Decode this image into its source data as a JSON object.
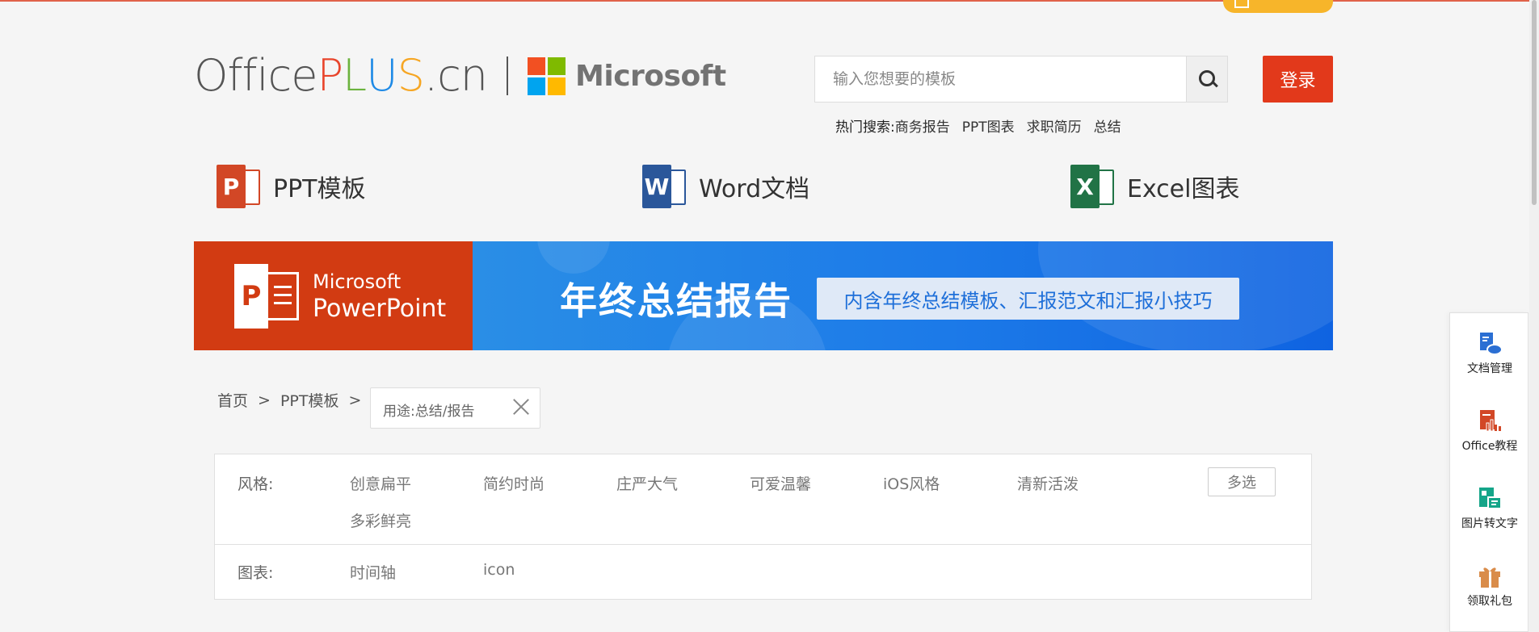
{
  "logo": {
    "office": "Office",
    "plus": [
      "P",
      "L",
      "U",
      "S"
    ],
    "domain": ".cn",
    "microsoft": "Microsoft"
  },
  "search": {
    "placeholder": "输入您想要的模板",
    "login_label": "登录",
    "hot_label": "热门搜索:",
    "hot_keywords": [
      "商务报告",
      "PPT图表",
      "求职简历",
      "总结"
    ]
  },
  "nav": {
    "ppt": {
      "label": "PPT模板",
      "letter": "P",
      "color": "#d24726"
    },
    "word": {
      "label": "Word文档",
      "letter": "W",
      "color": "#2b579a"
    },
    "excel": {
      "label": "Excel图表",
      "letter": "X",
      "color": "#217346"
    }
  },
  "banner": {
    "brand_line1": "Microsoft",
    "brand_line2": "PowerPoint",
    "brand_letter": "P",
    "title": "年终总结报告",
    "subtitle": "内含年终总结模板、汇报范文和汇报小技巧"
  },
  "breadcrumb": {
    "home": "首页",
    "sep": ">",
    "section": "PPT模板",
    "filter_tag": "用途:总结/报告"
  },
  "filters": {
    "style_label": "风格:",
    "style_options": [
      "创意扁平",
      "简约时尚",
      "庄严大气",
      "可爱温馨",
      "iOS风格",
      "清新活泼",
      "多彩鲜亮"
    ],
    "multi_label": "多选",
    "chart_label": "图表:",
    "chart_options": [
      "时间轴",
      "icon"
    ]
  },
  "sidebar": {
    "items": [
      {
        "label": "文档管理",
        "icon": "cloud-doc-icon",
        "color": "#2b6fd3"
      },
      {
        "label": "Office教程",
        "icon": "office-tutorial-icon",
        "color": "#d24726"
      },
      {
        "label": "图片转文字",
        "icon": "image-to-text-icon",
        "color": "#15a589"
      },
      {
        "label": "领取礼包",
        "icon": "gift-icon",
        "color": "#d98c4a"
      }
    ]
  },
  "colors": {
    "accent_red": "#e2391b",
    "plus_colors": [
      "#e8452c",
      "#6cb33e",
      "#1e8ae6",
      "#f6a623"
    ]
  }
}
